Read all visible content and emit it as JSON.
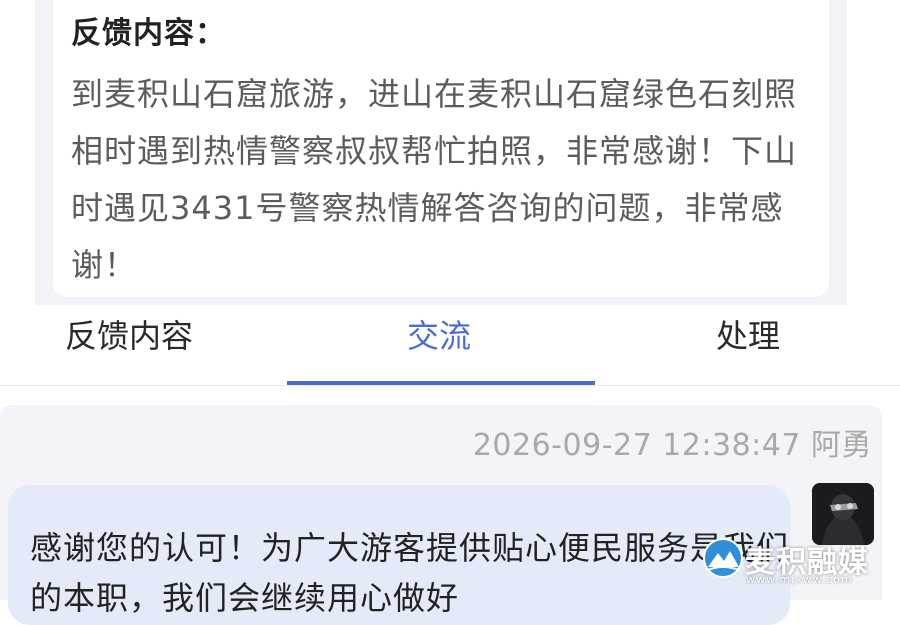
{
  "feedback": {
    "heading": "反馈内容：",
    "body": "到麦积山石窟旅游，进山在麦积山石窟绿色石刻照相时遇到热情警察叔叔帮忙拍照，非常感谢！下山时遇见3431号警察热情解答咨询的问题，非常感谢！"
  },
  "tabs": [
    {
      "label": "反馈内容",
      "active": false
    },
    {
      "label": "交流",
      "active": true
    },
    {
      "label": "处理",
      "active": false
    }
  ],
  "chat": {
    "timestamp": "2026-09-27 12:38:47",
    "author": "阿勇",
    "message": "感谢您的认可！为广大游客提供贴心便民服务是我们的本职，我们会继续用心做好"
  },
  "watermark": {
    "name": "麦积融媒",
    "url": "www.mjxww.com"
  },
  "colors": {
    "accent": "#4a6bd6",
    "bubble": "#e4eaf8",
    "chat_background": "#f3f4f8"
  }
}
